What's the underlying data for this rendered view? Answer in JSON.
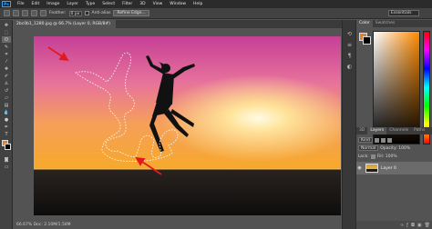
{
  "menu": {
    "logo": "Ps",
    "items": [
      "File",
      "Edit",
      "Image",
      "Layer",
      "Type",
      "Select",
      "Filter",
      "3D",
      "View",
      "Window",
      "Help"
    ]
  },
  "options": {
    "feather_label": "Feather:",
    "feather_value": "0 px",
    "antialias_label": "Anti-alias",
    "refine_label": "Refine Edge...",
    "workspace": "Essentials"
  },
  "document": {
    "tab_title": "2bc0b1_1280.jpg @ 66.7% (Layer 0, RGB/8#)",
    "status": "66.67%   Doc: 2.10M/1.54M"
  },
  "panels": {
    "color_tabs": [
      "Color",
      "Swatches"
    ],
    "layers_tabs": [
      "3D",
      "Layers",
      "Channels",
      "Paths"
    ],
    "kind_label": "Kind",
    "blend_mode": "Normal",
    "opacity_label": "Opacity: 100%",
    "lock_label": "Lock:",
    "fill_label": "Fill: 100%",
    "layer_name": "Layer 0"
  },
  "colors": {
    "foreground": "#f07f1a",
    "background": "#000000",
    "annotation_arrow": "#e3191c"
  },
  "icons": {
    "toolbar": [
      "move-icon",
      "marquee-icon",
      "lasso-icon",
      "quick-select-icon",
      "crop-icon",
      "eyedropper-icon",
      "healing-icon",
      "brush-icon",
      "clone-stamp-icon",
      "history-brush-icon",
      "eraser-icon",
      "gradient-icon",
      "blur-icon",
      "dodge-icon",
      "pen-icon",
      "type-icon",
      "path-select-icon",
      "shape-icon",
      "hand-icon",
      "zoom-icon"
    ],
    "strip": [
      "history-icon",
      "properties-icon",
      "paragraph-icon",
      "adjustments-icon"
    ]
  }
}
